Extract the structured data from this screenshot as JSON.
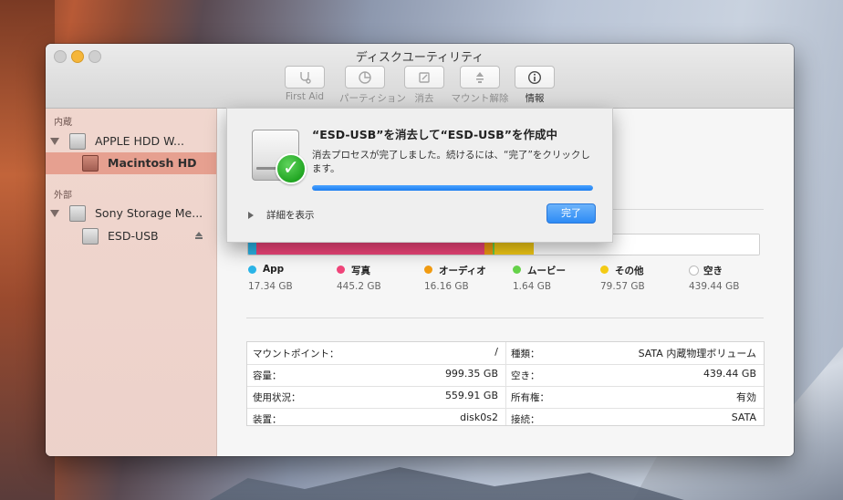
{
  "window": {
    "title": "ディスクユーティリティ"
  },
  "toolbar": [
    {
      "label": "First Aid",
      "icon": "stethoscope-icon",
      "enabled": false
    },
    {
      "label": "パーティション",
      "icon": "pie-partition-icon",
      "enabled": false
    },
    {
      "label": "消去",
      "icon": "erase-icon",
      "enabled": false
    },
    {
      "label": "マウント解除",
      "icon": "unmount-icon",
      "enabled": false
    },
    {
      "label": "情報",
      "icon": "info-icon",
      "enabled": true
    }
  ],
  "sidebar": {
    "internal_header": "内蔵",
    "external_header": "外部",
    "items": [
      {
        "label": "APPLE HDD W..."
      },
      {
        "label": "Macintosh HD",
        "selected": true
      },
      {
        "label": "Sony Storage Me..."
      },
      {
        "label": "ESD-USB"
      }
    ]
  },
  "usage": {
    "segments_pct": [
      {
        "color": "#2bb5e8",
        "pct": 1.6
      },
      {
        "color": "#f1457a",
        "pct": 44.6
      },
      {
        "color": "#f29c12",
        "pct": 1.6
      },
      {
        "color": "#66d34a",
        "pct": 0.4
      },
      {
        "color": "#f5cc16",
        "pct": 7.7
      },
      {
        "color": "#ffffff",
        "pct": 44.1
      }
    ],
    "legend": [
      {
        "name": "App",
        "size": "17.34 GB",
        "color": "#2bb5e8"
      },
      {
        "name": "写真",
        "size": "445.2 GB",
        "color": "#f1457a"
      },
      {
        "name": "オーディオ",
        "size": "16.16 GB",
        "color": "#f29c12"
      },
      {
        "name": "ムービー",
        "size": "1.64 GB",
        "color": "#66d34a"
      },
      {
        "name": "その他",
        "size": "79.57 GB",
        "color": "#f5cc16"
      },
      {
        "name": "空き",
        "size": "439.44 GB",
        "color": "#ffffff"
      }
    ]
  },
  "info": {
    "left": [
      {
        "key": "マウントポイント：",
        "value": "/"
      },
      {
        "key": "容量：",
        "value": "999.35 GB"
      },
      {
        "key": "使用状況：",
        "value": "559.91 GB"
      },
      {
        "key": "装置：",
        "value": "disk0s2"
      }
    ],
    "right": [
      {
        "key": "種類：",
        "value": "SATA 内蔵物理ボリューム"
      },
      {
        "key": "空き：",
        "value": "439.44 GB"
      },
      {
        "key": "所有権：",
        "value": "有効"
      },
      {
        "key": "接続：",
        "value": "SATA"
      }
    ]
  },
  "sheet": {
    "title": "“ESD-USB”を消去して“ESD-USB”を作成中",
    "message": "消去プロセスが完了しました。続けるには、“完了”をクリックします。",
    "progress": 100,
    "details_label": "詳細を表示",
    "done_label": "完了"
  }
}
